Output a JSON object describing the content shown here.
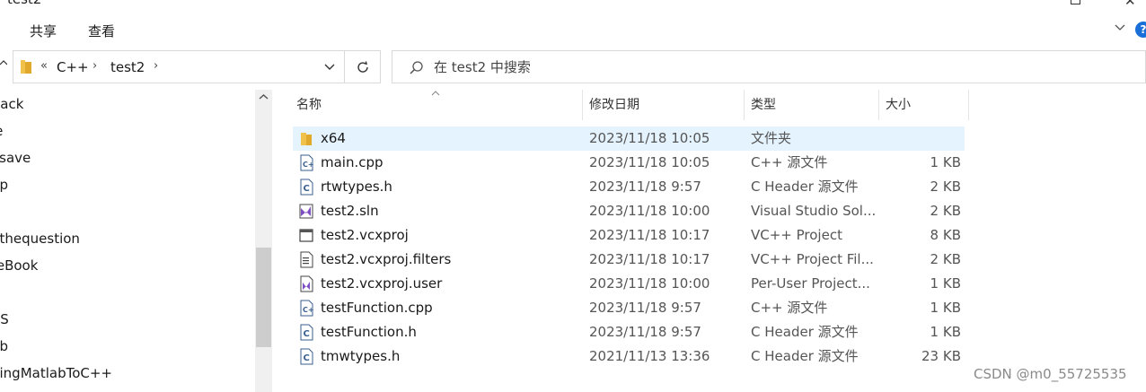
{
  "window": {
    "title": "test2"
  },
  "ribbon": {
    "tabs": [
      "共享",
      "查看"
    ]
  },
  "address": {
    "overflow": "«",
    "crumbs": [
      "C++",
      "test2"
    ]
  },
  "search": {
    "placeholder": "在 test2 中搜索"
  },
  "nav": {
    "items": [
      "Back",
      "le",
      "osave",
      "up",
      "K",
      "nthequestion",
      "reBook",
      "",
      "AS",
      "ub",
      "ningMatlabToC++"
    ]
  },
  "columns": {
    "name": "名称",
    "date": "修改日期",
    "type": "类型",
    "size": "大小"
  },
  "files": [
    {
      "name": "x64",
      "date": "2023/11/18 10:05",
      "type": "文件夹",
      "size": "",
      "icon": "folder-icon",
      "selected": true
    },
    {
      "name": "main.cpp",
      "date": "2023/11/18 10:05",
      "type": "C++ 源文件",
      "size": "1 KB",
      "icon": "cpp-file-icon"
    },
    {
      "name": "rtwtypes.h",
      "date": "2023/11/18 9:57",
      "type": "C Header 源文件",
      "size": "2 KB",
      "icon": "header-file-icon"
    },
    {
      "name": "test2.sln",
      "date": "2023/11/18 10:00",
      "type": "Visual Studio Sol...",
      "size": "2 KB",
      "icon": "solution-file-icon"
    },
    {
      "name": "test2.vcxproj",
      "date": "2023/11/18 10:17",
      "type": "VC++ Project",
      "size": "8 KB",
      "icon": "vcxproj-file-icon"
    },
    {
      "name": "test2.vcxproj.filters",
      "date": "2023/11/18 10:17",
      "type": "VC++ Project Fil...",
      "size": "2 KB",
      "icon": "filters-file-icon"
    },
    {
      "name": "test2.vcxproj.user",
      "date": "2023/11/18 10:00",
      "type": "Per-User Project...",
      "size": "1 KB",
      "icon": "user-file-icon"
    },
    {
      "name": "testFunction.cpp",
      "date": "2023/11/18 9:57",
      "type": "C++ 源文件",
      "size": "1 KB",
      "icon": "cpp-file-icon"
    },
    {
      "name": "testFunction.h",
      "date": "2023/11/18 9:57",
      "type": "C Header 源文件",
      "size": "1 KB",
      "icon": "header-file-icon"
    },
    {
      "name": "tmwtypes.h",
      "date": "2021/11/13 13:36",
      "type": "C Header 源文件",
      "size": "23 KB",
      "icon": "header-file-icon"
    }
  ],
  "watermark": "CSDN @m0_55725535",
  "colors": {
    "selection": "#e5f3ff",
    "folder": "#f0c24b",
    "accent": "#1a6fd8",
    "vs_purple": "#7e4fc4"
  }
}
